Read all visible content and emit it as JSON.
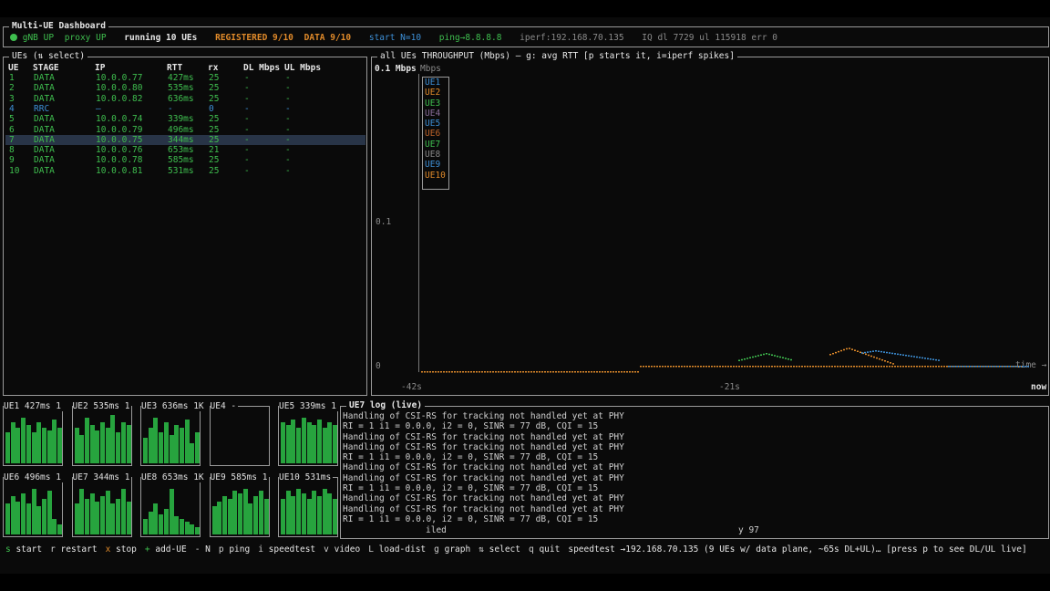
{
  "header": {
    "title": "Multi-UE Dashboard",
    "gnb_status": "gNB UP",
    "proxy_status": "proxy UP",
    "running": "running 10 UEs",
    "registered": "REGISTERED 9/10",
    "data": "DATA 9/10",
    "start": "start N=10",
    "ping": "ping→8.8.8.8",
    "iperf": "iperf:192.168.70.135",
    "iq": "IQ dl 7729 ul 115918 err 0"
  },
  "ue_table": {
    "title": "UEs (⇅ select)",
    "columns": [
      "UE",
      "STAGE",
      "IP",
      "RTT",
      "rx",
      "DL Mbps",
      "UL Mbps"
    ],
    "rows": [
      {
        "ue": "1",
        "stage": "DATA",
        "ip": "10.0.0.77",
        "rtt": "427ms",
        "rx": "25",
        "dl": "-",
        "ul": "-",
        "color": "green"
      },
      {
        "ue": "2",
        "stage": "DATA",
        "ip": "10.0.0.80",
        "rtt": "535ms",
        "rx": "25",
        "dl": "-",
        "ul": "-",
        "color": "green"
      },
      {
        "ue": "3",
        "stage": "DATA",
        "ip": "10.0.0.82",
        "rtt": "636ms",
        "rx": "25",
        "dl": "-",
        "ul": "-",
        "color": "green"
      },
      {
        "ue": "4",
        "stage": "RRC",
        "ip": "—",
        "rtt": "-",
        "rx": "0",
        "dl": "-",
        "ul": "-",
        "color": "blue"
      },
      {
        "ue": "5",
        "stage": "DATA",
        "ip": "10.0.0.74",
        "rtt": "339ms",
        "rx": "25",
        "dl": "-",
        "ul": "-",
        "color": "green"
      },
      {
        "ue": "6",
        "stage": "DATA",
        "ip": "10.0.0.79",
        "rtt": "496ms",
        "rx": "25",
        "dl": "-",
        "ul": "-",
        "color": "green"
      },
      {
        "ue": "7",
        "stage": "DATA",
        "ip": "10.0.0.75",
        "rtt": "344ms",
        "rx": "25",
        "dl": "-",
        "ul": "-",
        "color": "green",
        "selected": true
      },
      {
        "ue": "8",
        "stage": "DATA",
        "ip": "10.0.0.76",
        "rtt": "653ms",
        "rx": "21",
        "dl": "-",
        "ul": "-",
        "color": "green"
      },
      {
        "ue": "9",
        "stage": "DATA",
        "ip": "10.0.0.78",
        "rtt": "585ms",
        "rx": "25",
        "dl": "-",
        "ul": "-",
        "color": "green"
      },
      {
        "ue": "10",
        "stage": "DATA",
        "ip": "10.0.0.81",
        "rtt": "531ms",
        "rx": "25",
        "dl": "-",
        "ul": "-",
        "color": "green"
      }
    ]
  },
  "throughput": {
    "title": "all UEs THROUGHPUT (Mbps) — g: avg RTT  [p starts it, i=iperf spikes]",
    "top_label": "0.1 Mbps",
    "unit_label": "Mbps",
    "y_mid": "0.1",
    "y_zero": "0",
    "x_left": "-42s",
    "x_mid": "-21s",
    "x_right": "now",
    "time_label": "time →",
    "legend": [
      {
        "name": "UE1",
        "color": "#3d8fd6"
      },
      {
        "name": "UE2",
        "color": "#e08a2a"
      },
      {
        "name": "UE3",
        "color": "#3fbf4f"
      },
      {
        "name": "UE4",
        "color": "#8a6e9a"
      },
      {
        "name": "UE5",
        "color": "#3d8fd6"
      },
      {
        "name": "UE6",
        "color": "#c0642a"
      },
      {
        "name": "UE7",
        "color": "#3fbf4f"
      },
      {
        "name": "UE8",
        "color": "#8a8a8a"
      },
      {
        "name": "UE9",
        "color": "#3d8fd6"
      },
      {
        "name": "UE10",
        "color": "#e08a2a"
      }
    ]
  },
  "mini_panels": [
    {
      "label": "UE1 427ms 1",
      "bars": [
        0.6,
        0.8,
        0.7,
        0.9,
        0.75,
        0.6,
        0.8,
        0.7,
        0.65,
        0.85,
        0.7
      ]
    },
    {
      "label": "UE2 535ms 1",
      "bars": [
        0.7,
        0.55,
        0.9,
        0.75,
        0.65,
        0.8,
        0.7,
        0.95,
        0.6,
        0.8,
        0.75
      ]
    },
    {
      "label": "UE3 636ms 1K",
      "bars": [
        0.5,
        0.7,
        0.9,
        0.6,
        0.8,
        0.55,
        0.75,
        0.7,
        0.85,
        0.4,
        0.6
      ]
    },
    {
      "label": "UE4 -",
      "bars": []
    },
    {
      "label": "UE5 339ms 1",
      "bars": [
        0.8,
        0.75,
        0.85,
        0.7,
        0.9,
        0.8,
        0.75,
        0.85,
        0.7,
        0.8,
        0.75
      ]
    },
    {
      "label": "UE6 496ms 1",
      "bars": [
        0.6,
        0.75,
        0.65,
        0.8,
        0.6,
        0.9,
        0.55,
        0.7,
        0.85,
        0.3,
        0.2
      ]
    },
    {
      "label": "UE7 344ms 1",
      "bars": [
        0.6,
        0.9,
        0.7,
        0.8,
        0.65,
        0.75,
        0.85,
        0.6,
        0.7,
        0.9,
        0.65
      ]
    },
    {
      "label": "UE8 653ms 1K",
      "bars": [
        0.3,
        0.45,
        0.6,
        0.4,
        0.5,
        0.9,
        0.35,
        0.3,
        0.25,
        0.2,
        0.15
      ]
    },
    {
      "label": "UE9 585ms 1",
      "bars": [
        0.55,
        0.65,
        0.75,
        0.7,
        0.85,
        0.8,
        0.9,
        0.6,
        0.75,
        0.85,
        0.7
      ]
    },
    {
      "label": "UE10 531ms",
      "bars": [
        0.7,
        0.85,
        0.75,
        0.9,
        0.8,
        0.7,
        0.85,
        0.75,
        0.9,
        0.8,
        0.7
      ]
    }
  ],
  "log": {
    "title": "UE7 log (live)",
    "lines": [
      "Handling of CSI-RS for tracking not handled yet at PHY",
      "RI = 1 i1 = 0.0.0, i2 = 0, SINR = 77 dB, CQI = 15",
      "Handling of CSI-RS for tracking not handled yet at PHY",
      "Handling of CSI-RS for tracking not handled yet at PHY",
      "RI = 1 i1 = 0.0.0, i2 = 0, SINR = 77 dB, CQI = 15",
      "Handling of CSI-RS for tracking not handled yet at PHY",
      "Handling of CSI-RS for tracking not handled yet at PHY",
      "RI = 1 i1 = 0.0.0, i2 = 0, SINR = 77 dB, CQI = 15",
      "Handling of CSI-RS for tracking not handled yet at PHY",
      "Handling of CSI-RS for tracking not handled yet at PHY",
      "RI = 1 i1 = 0.0.0, i2 = 0, SINR = 77 dB, CQI = 15"
    ],
    "tail_left": "iled",
    "tail_right": "y 97"
  },
  "footer": {
    "keys": [
      {
        "key": "s",
        "label": "start",
        "color": "#3fbf4f"
      },
      {
        "key": "r",
        "label": "restart",
        "color": "#d0d0d0"
      },
      {
        "key": "x",
        "label": "stop",
        "color": "#e08a2a"
      },
      {
        "key": "+",
        "label": "add-UE",
        "color": "#3fbf4f"
      },
      {
        "key": "-",
        "label": "N",
        "color": "#d0d0d0"
      },
      {
        "key": "p",
        "label": "ping",
        "color": "#d0d0d0"
      },
      {
        "key": "i",
        "label": "speedtest",
        "color": "#d0d0d0"
      },
      {
        "key": "v",
        "label": "video",
        "color": "#d0d0d0"
      },
      {
        "key": "L",
        "label": "load-dist",
        "color": "#d0d0d0"
      },
      {
        "key": "g",
        "label": "graph",
        "color": "#d0d0d0"
      },
      {
        "key": "⇅",
        "label": "select",
        "color": "#d0d0d0"
      },
      {
        "key": "q",
        "label": "quit",
        "color": "#d0d0d0"
      }
    ],
    "status": "speedtest →192.168.70.135 (9 UEs w/ data plane, ~65s DL+UL)… [press p to see DL/UL live]"
  },
  "colors": {
    "green": "#3fbf4f",
    "blue": "#3d8fd6",
    "orange": "#e08a2a",
    "selection": "#283447"
  }
}
